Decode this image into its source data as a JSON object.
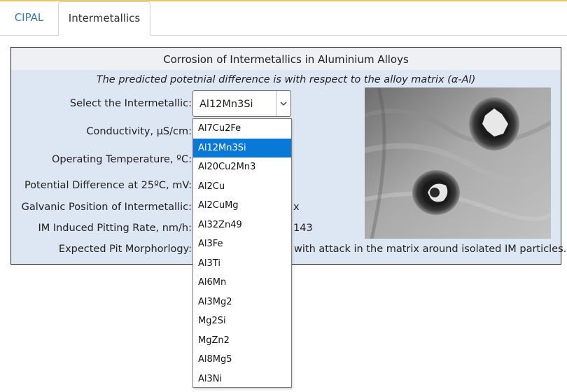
{
  "tabs": [
    {
      "label": "CIPAL"
    },
    {
      "label": "Intermetallics"
    }
  ],
  "panel": {
    "title": "Corrosion of Intermetallics in Aluminium Alloys",
    "subtitle": "The predicted potetnial difference is with respect to the alloy matrix (α-Al)"
  },
  "form": {
    "select_label": "Select the Intermetallic:",
    "selected_value": "Al12Mn3Si",
    "conductivity_label": "Conductivity, μS/cm:",
    "temperature_label": "Operating Temperature, ºC:",
    "potential_label": "Potential Difference at 25ºC, mV:",
    "galvanic_label": "Galvanic Position of Intermetallic:",
    "galvanic_value_partial": "x",
    "pitting_label": "IM Induced Pitting Rate, nm/h:",
    "pitting_value_partial": "143",
    "morphology_label": "Expected Pit Morphorlogy:",
    "morphology_value_partial": "with attack in the matrix around isolated IM particles."
  },
  "dropdown": {
    "options": [
      "Al7Cu2Fe",
      "Al12Mn3Si",
      "Al20Cu2Mn3",
      "Al2Cu",
      "Al2CuMg",
      "Al32Zn49",
      "Al3Fe",
      "Al3Ti",
      "Al6Mn",
      "Al3Mg2",
      "Mg2Si",
      "MgZn2",
      "Al8Mg5",
      "Al3Ni"
    ],
    "highlighted_index": 1
  },
  "icons": {
    "select_arrow": "chevron-down-icon",
    "image": "micrograph-image"
  },
  "colors": {
    "accent_link": "#3a78b7",
    "panel_bg": "#dde6f3",
    "selection_highlight": "#0a78d7"
  }
}
